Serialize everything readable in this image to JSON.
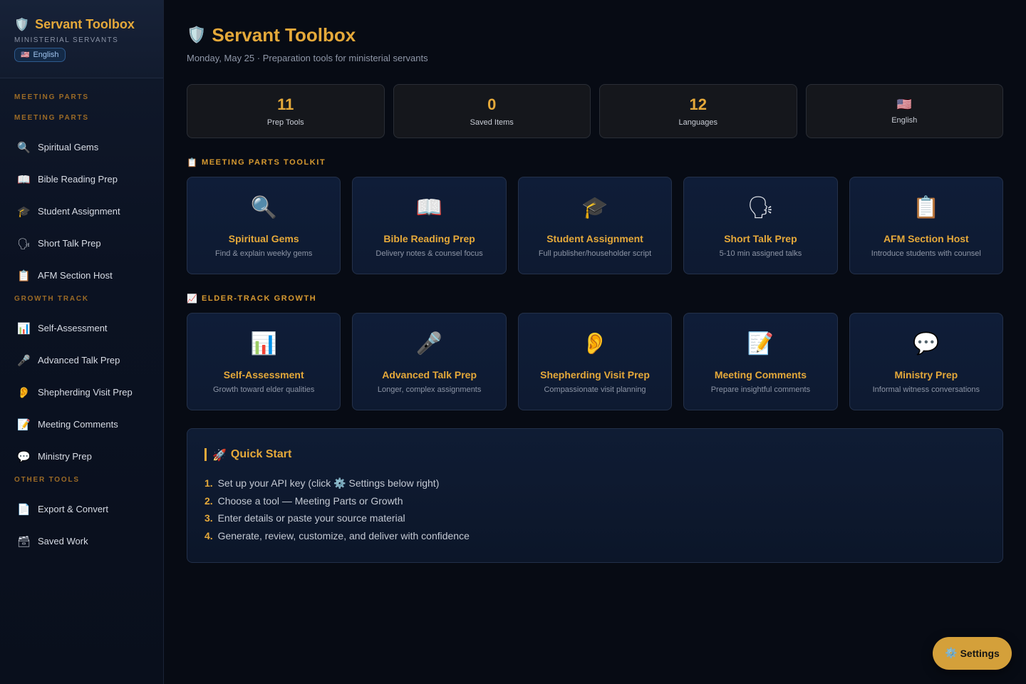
{
  "brand": {
    "title": "Servant Toolbox",
    "subtitle": "MINISTERIAL SERVANTS",
    "language": "English",
    "icon": "shield-icon"
  },
  "sidebar": {
    "sections": [
      {
        "label": "MEETING PARTS"
      },
      {
        "label": "MEETING PARTS"
      },
      {
        "label": "GROWTH TRACK"
      },
      {
        "label": "OTHER TOOLS"
      }
    ],
    "meeting_items": [
      {
        "icon": "🔍",
        "label": "Spiritual Gems"
      },
      {
        "icon": "📖",
        "label": "Bible Reading Prep"
      },
      {
        "icon": "🎓",
        "label": "Student Assignment"
      },
      {
        "icon": "🗣",
        "label": "Short Talk Prep"
      },
      {
        "icon": "📋",
        "label": "AFM Section Host"
      }
    ],
    "growth_items": [
      {
        "icon": "📊",
        "label": "Self-Assessment"
      },
      {
        "icon": "🎤",
        "label": "Advanced Talk Prep"
      },
      {
        "icon": "👂",
        "label": "Shepherding Visit Prep"
      },
      {
        "icon": "📝",
        "label": "Meeting Comments"
      },
      {
        "icon": "💬",
        "label": "Ministry Prep"
      }
    ],
    "other_items": [
      {
        "icon": "📄",
        "label": "Export & Convert"
      },
      {
        "icon": "🗃",
        "label": "Saved Work"
      }
    ]
  },
  "header": {
    "title": "Servant Toolbox",
    "subtitle": "Monday, May 25 · Preparation tools for ministerial servants"
  },
  "stats": [
    {
      "value": "11",
      "label": "Prep Tools"
    },
    {
      "value": "0",
      "label": "Saved Items"
    },
    {
      "value": "12",
      "label": "Languages"
    },
    {
      "flag": "🇺🇸",
      "label": "English"
    }
  ],
  "meeting_toolkit": {
    "heading": "MEETING PARTS TOOLKIT",
    "icon": "📋",
    "cards": [
      {
        "icon": "🔍",
        "title": "Spiritual Gems",
        "desc": "Find & explain weekly gems"
      },
      {
        "icon": "📖",
        "title": "Bible Reading Prep",
        "desc": "Delivery notes & counsel focus"
      },
      {
        "icon": "🎓",
        "title": "Student Assignment",
        "desc": "Full publisher/householder script"
      },
      {
        "icon": "🗣",
        "title": "Short Talk Prep",
        "desc": "5-10 min assigned talks"
      },
      {
        "icon": "📋",
        "title": "AFM Section Host",
        "desc": "Introduce students with counsel"
      }
    ]
  },
  "growth": {
    "heading": "ELDER-TRACK GROWTH",
    "icon": "📈",
    "cards": [
      {
        "icon": "📊",
        "title": "Self-Assessment",
        "desc": "Growth toward elder qualities"
      },
      {
        "icon": "🎤",
        "title": "Advanced Talk Prep",
        "desc": "Longer, complex assignments"
      },
      {
        "icon": "👂",
        "title": "Shepherding Visit Prep",
        "desc": "Compassionate visit planning"
      },
      {
        "icon": "📝",
        "title": "Meeting Comments",
        "desc": "Prepare insightful comments"
      },
      {
        "icon": "💬",
        "title": "Ministry Prep",
        "desc": "Informal witness conversations"
      }
    ]
  },
  "quick_start": {
    "title": "Quick Start",
    "icon": "🚀",
    "steps": [
      {
        "num": "1.",
        "text": "Set up your API key (click ⚙️ Settings below right)"
      },
      {
        "num": "2.",
        "text": "Choose a tool — Meeting Parts or Growth"
      },
      {
        "num": "3.",
        "text": "Enter details or paste your source material"
      },
      {
        "num": "4.",
        "text": "Generate, review, customize, and deliver with confidence"
      }
    ]
  },
  "settings_button": {
    "icon": "⚙️",
    "label": "Settings"
  },
  "colors": {
    "accent": "#e5a93a",
    "background": "#070b14",
    "card": "#0f1d38"
  }
}
